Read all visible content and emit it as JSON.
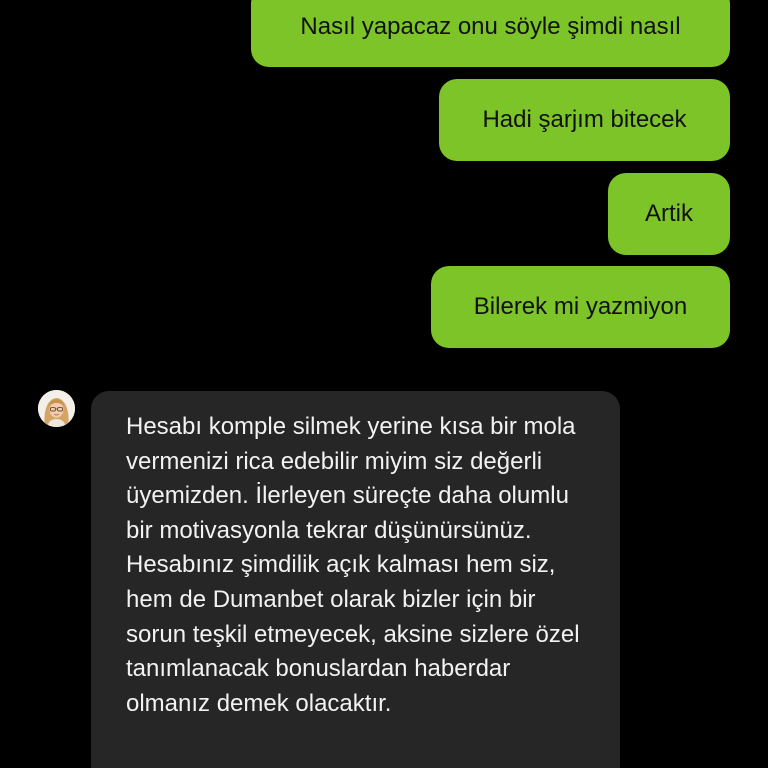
{
  "conversation": {
    "outgoing": [
      {
        "text": "Nasıl yapacaz onu söyle şimdi nasıl"
      },
      {
        "text": "Hadi şarjım bitecek"
      },
      {
        "text": "Artik"
      },
      {
        "text": "Bilerek mi yazmiyon"
      }
    ],
    "incoming": {
      "avatar_icon": "agent-avatar",
      "text": "Hesabı komple silmek yerine kısa bir mola vermenizi rica edebilir miyim siz değerli üyemizden. İlerleyen süreçte daha olumlu bir motivasyonla tekrar düşünürsünüz. Hesabınız şimdilik açık kalması hem siz, hem de Dumanbet olarak bizler için bir sorun teşkil etmeyecek, aksine sizlere özel tanımlanacak bonuslardan haberdar olmanız demek olacaktır."
    }
  },
  "colors": {
    "background": "#000000",
    "outgoing_bubble": "#7cc427",
    "incoming_bubble": "#262626",
    "incoming_text": "#f2f2f2"
  }
}
